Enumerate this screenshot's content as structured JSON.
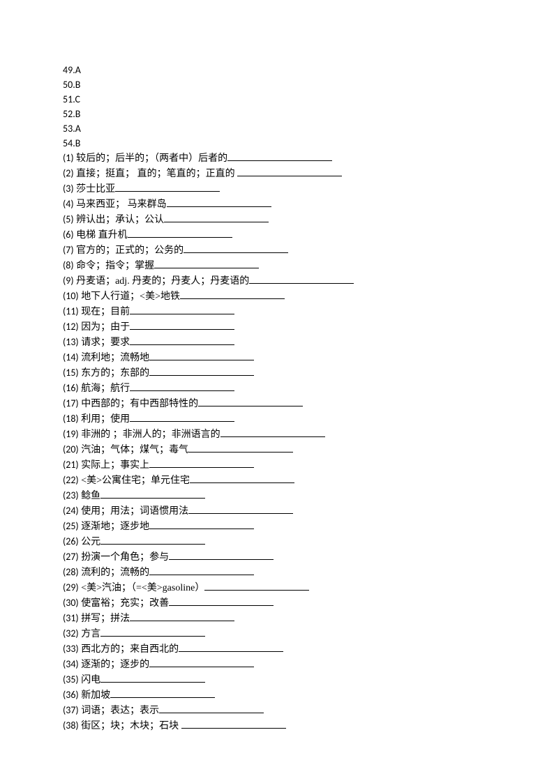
{
  "answers": [
    {
      "num": "49",
      "letter": "A"
    },
    {
      "num": "50",
      "letter": "B"
    },
    {
      "num": "51",
      "letter": "C"
    },
    {
      "num": "52",
      "letter": "B"
    },
    {
      "num": "53",
      "letter": "A"
    },
    {
      "num": "54",
      "letter": "B"
    }
  ],
  "vocab": [
    {
      "num": "(1)",
      "text": " 较后的；后半的；（两者中）后者的",
      "blank": 150
    },
    {
      "num": "(2)",
      "text": "  直接；挺直；  直的；笔直的；正直的 ",
      "blank": 150
    },
    {
      "num": "(3)",
      "text": " 莎士比亚",
      "blank": 150
    },
    {
      "num": "(4)",
      "text": "  马来西亚； 马来群岛",
      "blank": 150
    },
    {
      "num": "(5)",
      "text": "  辨认出；承认；公认",
      "blank": 150
    },
    {
      "num": "(6)",
      "text": " 电梯 直升机",
      "blank": 150
    },
    {
      "num": "(7)",
      "text": "  官方的；正式的；公务的",
      "blank": 150
    },
    {
      "num": "(8)",
      "text": "  命令；指令；掌握",
      "blank": 150
    },
    {
      "num": "(9)",
      "text": "  丹麦语；adj. 丹麦的；丹麦人；丹麦语的",
      "blank": 150
    },
    {
      "num": "(10)",
      "text": " 地下人行道；<美>地铁",
      "blank": 150
    },
    {
      "num": "(11)",
      "text": " 现在；目前",
      "blank": 150
    },
    {
      "num": "(12)",
      "text": "   因为；由于",
      "blank": 150
    },
    {
      "num": "(13)",
      "text": "   请求；要求",
      "blank": 150
    },
    {
      "num": "(14)",
      "text": " 流利地；流畅地",
      "blank": 150
    },
    {
      "num": "(15)",
      "text": "   东方的；东部的",
      "blank": 150
    },
    {
      "num": "(16)",
      "text": "  航海；航行",
      "blank": 150
    },
    {
      "num": "(17)",
      "text": "  中西部的；有中西部特性的",
      "blank": 150
    },
    {
      "num": "(18)",
      "text": "  利用；使用",
      "blank": 150
    },
    {
      "num": "(19)",
      "text": "  非洲的 ；非洲人的；非洲语言的",
      "blank": 150
    },
    {
      "num": "(20)",
      "text": "   汽油；气体；煤气；毒气",
      "blank": 150
    },
    {
      "num": "(21)",
      "text": " 实际上；事实上",
      "blank": 150
    },
    {
      "num": "(22)",
      "text": " <美>公寓住宅；单元住宅",
      "blank": 150
    },
    {
      "num": "(23)",
      "text": "    鲶鱼",
      "blank": 150
    },
    {
      "num": "(24)",
      "text": " 使用；用法；词语惯用法",
      "blank": 150
    },
    {
      "num": "(25)",
      "text": " 逐渐地；逐步地",
      "blank": 150
    },
    {
      "num": "(26)",
      "text": " 公元",
      "blank": 150
    },
    {
      "num": "(27)",
      "text": "   扮演一个角色；参与",
      "blank": 150
    },
    {
      "num": "(28)",
      "text": " 流利的；流畅的",
      "blank": 150
    },
    {
      "num": "(29)",
      "text": "   <美>汽油；（=<美>gasoline）",
      "blank": 150
    },
    {
      "num": "(30)",
      "text": " 使富裕；充实；改善",
      "blank": 150
    },
    {
      "num": "(31)",
      "text": " 拼写；拼法",
      "blank": 150
    },
    {
      "num": "(32)",
      "text": " 方言",
      "blank": 150
    },
    {
      "num": "(33)",
      "text": "  西北方的；来自西北的",
      "blank": 150
    },
    {
      "num": "(34)",
      "text": "   逐渐的；逐步的",
      "blank": 150
    },
    {
      "num": "(35)",
      "text": " 闪电",
      "blank": 150
    },
    {
      "num": "(36)",
      "text": "   新加坡",
      "blank": 150
    },
    {
      "num": "(37)",
      "text": "   词语；表达；表示",
      "blank": 150
    },
    {
      "num": "(38)",
      "text": "    街区；块；木块；石块 ",
      "blank": 150
    }
  ]
}
